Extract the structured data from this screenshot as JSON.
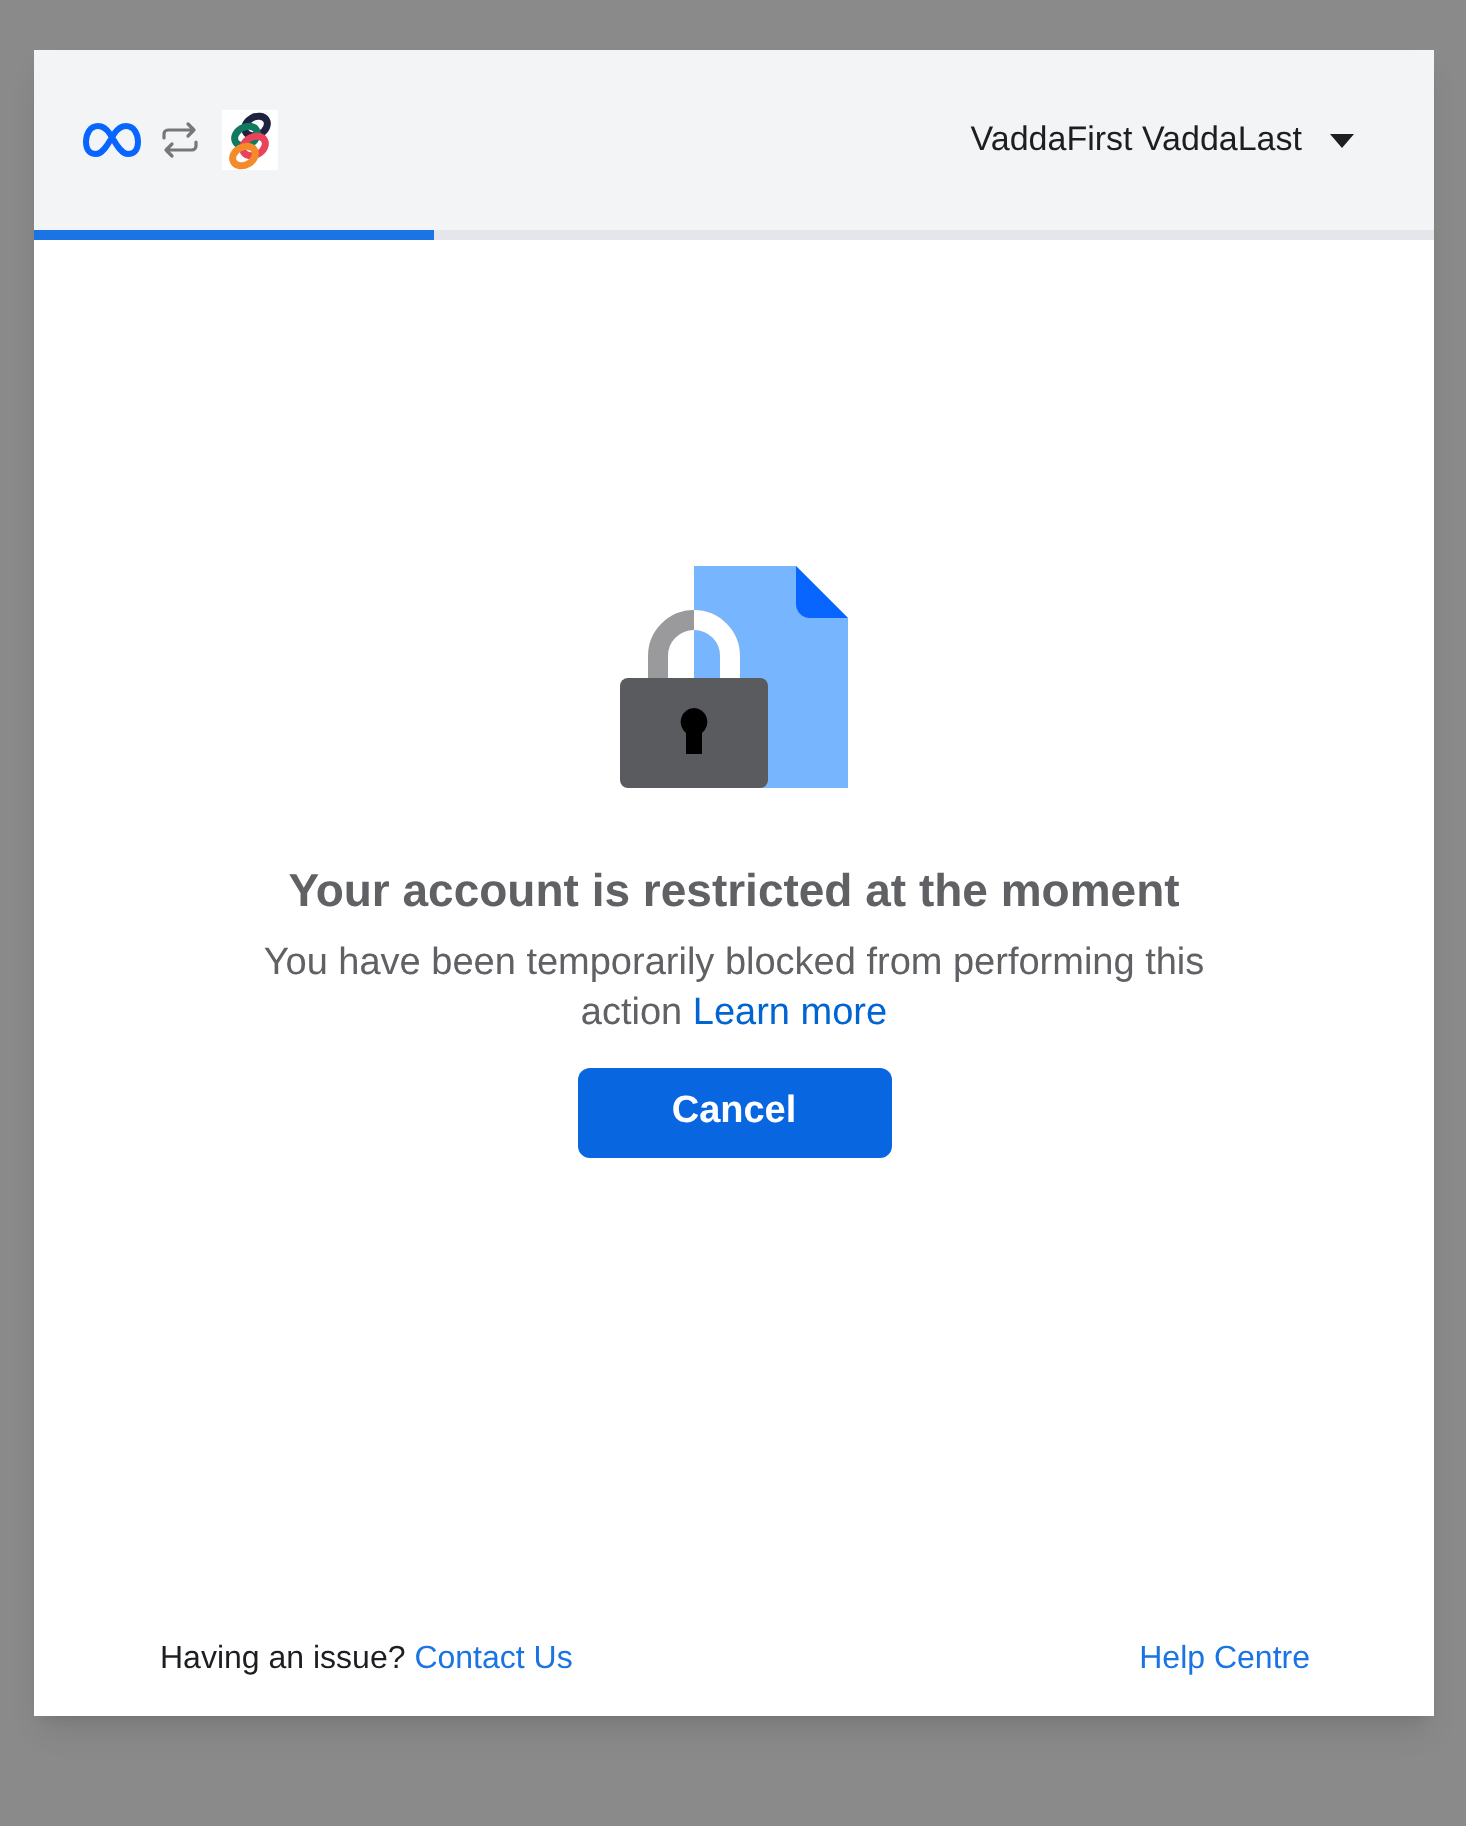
{
  "header": {
    "account_name": "VaddaFirst VaddaLast"
  },
  "progress": {
    "level": 0.286
  },
  "message": {
    "title": "Your account is restricted at the moment",
    "body": "You have been temporarily blocked from performing this action",
    "link": "Learn more"
  },
  "button": "Cancel",
  "footer": {
    "question": "Having an issue?",
    "contact_link": "Contact Us",
    "help_link": "Help Centre"
  }
}
